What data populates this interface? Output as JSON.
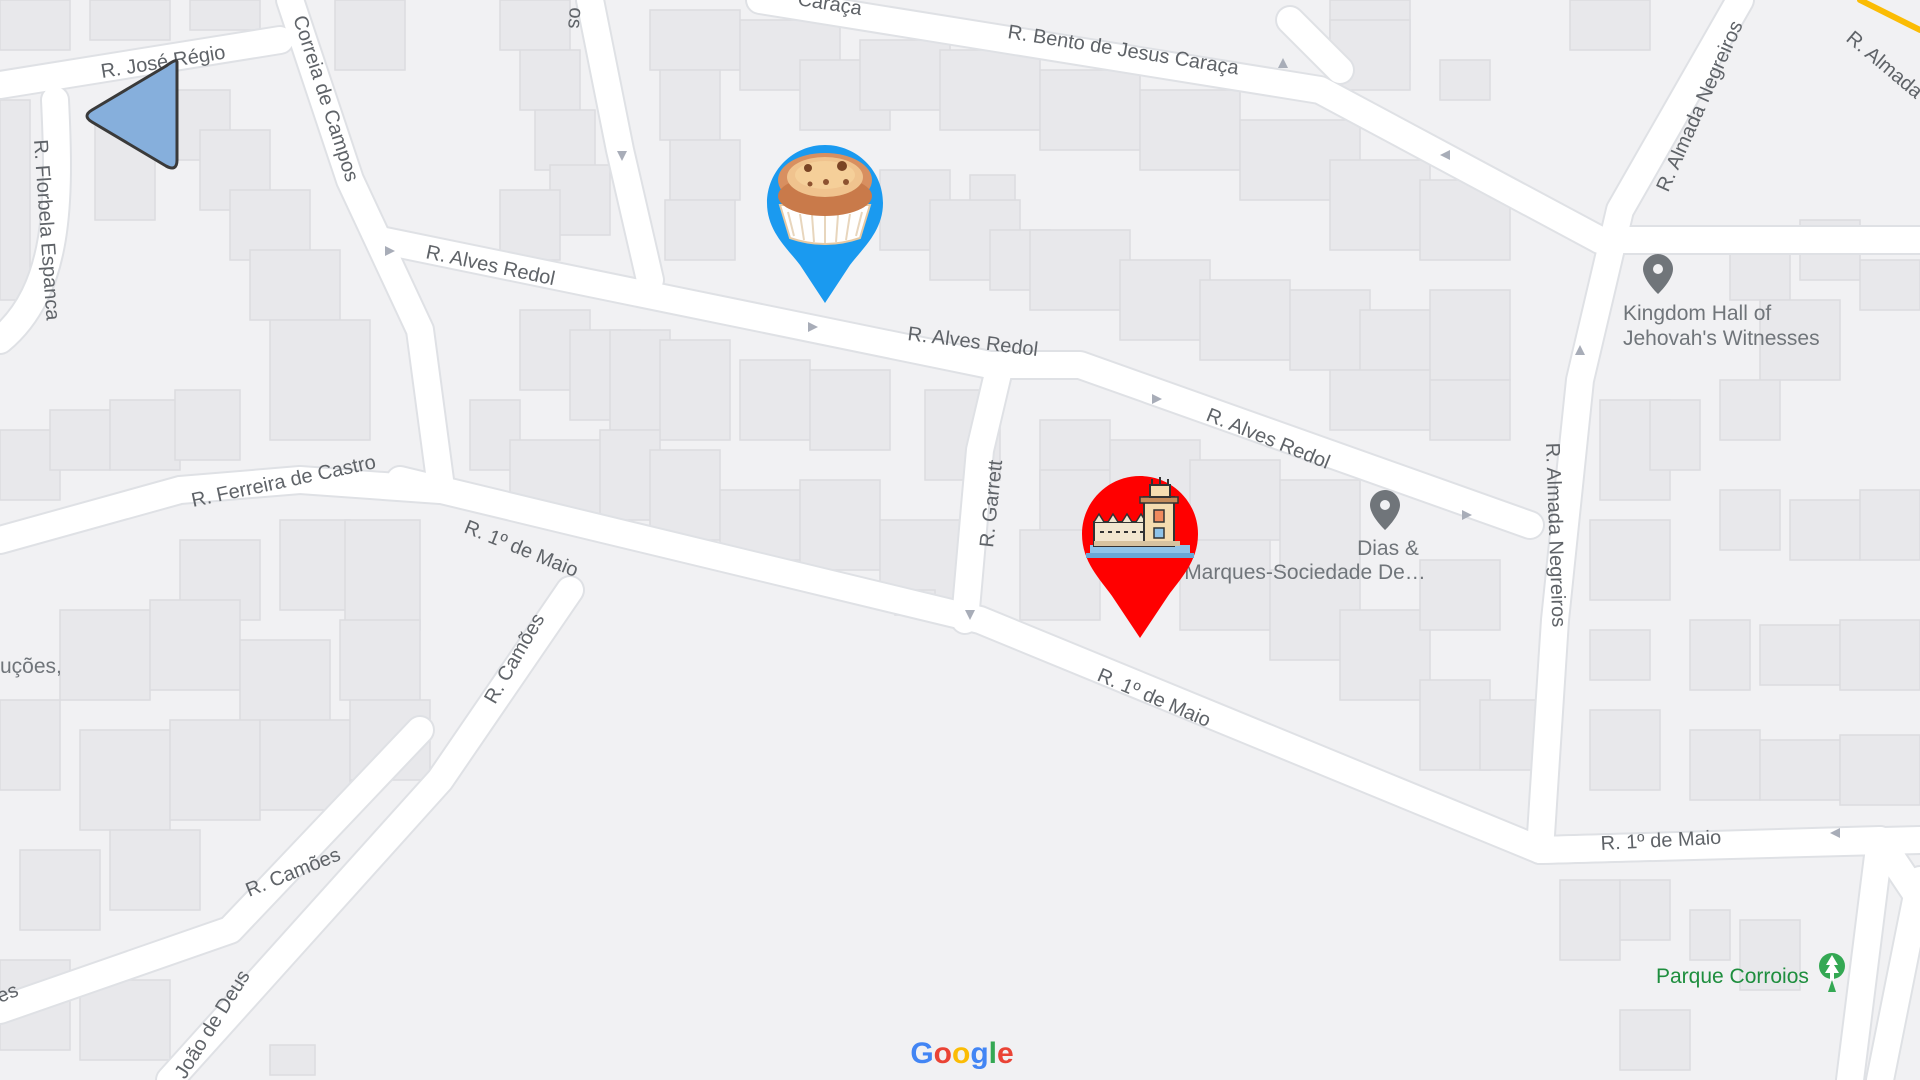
{
  "map": {
    "streets": {
      "jose_regio": "R. José Régio",
      "correia_de_campos": "Correia de Campos",
      "florbela_espanca": "R. Florbela Espanca",
      "bento_de_jesus_caraca": "R. Bento de Jesus Caraça",
      "bento_top_fragment": "Caraça",
      "alves_redol_1": "R. Alves Redol",
      "alves_redol_2": "R. Alves Redol",
      "alves_redol_3": "R. Alves Redol",
      "almada_negreiros_1": "R. Almada Negreiros",
      "almada_negreiros_2": "R. Almada Negreiros",
      "almada_top_right": "R. Almada",
      "ferreira_de_castro": "R. Ferreira de Castro",
      "primeiro_de_maio_1": "R. 1º de Maio",
      "primeiro_de_maio_2": "R. 1º de Maio",
      "primeiro_de_maio_3": "R. 1º de Maio",
      "garrett": "R. Garrett",
      "camoes_1": "R. Camões",
      "camoes_2": "R. Camões",
      "joao_de_deus": "João de Deus",
      "top_fragment_os": "os",
      "left_fragment_es": "es"
    },
    "pois": {
      "kingdom_hall_line1": "Kingdom Hall of",
      "kingdom_hall_line2": "Jehovah's Witnesses",
      "dias_line1": "Dias &",
      "dias_line2": "Marques-Sociedade De…",
      "left_fragment": "uções,",
      "parque": "Parque Corroios"
    },
    "markers": [
      {
        "name": "pastry-marker",
        "icon": "pastel-de-nata-icon",
        "color": "#1a9af0"
      },
      {
        "name": "landmark-marker",
        "icon": "belem-tower-icon",
        "color": "#ff0000"
      }
    ],
    "navigation_arrow": {
      "icon": "navigation-arrow-icon",
      "color": "#86afdc"
    },
    "logo": "Google",
    "colors": {
      "background": "#f1f1f3",
      "road": "#ffffff",
      "building": "#e8e8eb",
      "park_green": "#1e8e3e"
    }
  }
}
